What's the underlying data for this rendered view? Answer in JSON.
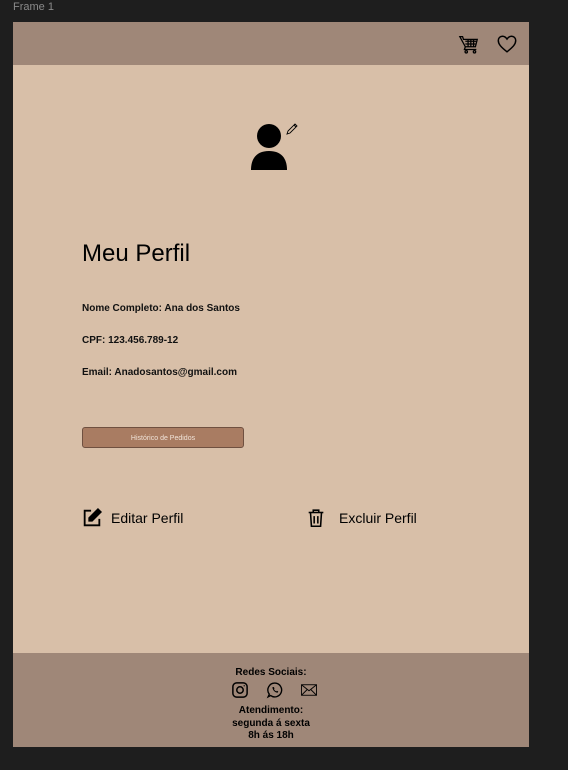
{
  "frame": {
    "label": "Frame 1"
  },
  "header": {
    "icons": [
      "cart-icon",
      "heart-icon"
    ]
  },
  "profile": {
    "title": "Meu Perfil",
    "full_name": "Nome Completo: Ana dos Santos",
    "cpf": "CPF: 123.456.789-12",
    "email": "Email: Anadosantos@gmail.com",
    "orders_button": "Histórico de Pedidos",
    "edit_label": "Editar Perfil",
    "delete_label": "Excluir Perfil"
  },
  "footer": {
    "social_title": "Redes Sociais:",
    "social_icons": [
      "instagram-icon",
      "whatsapp-icon",
      "mail-icon"
    ],
    "hours_title": "Atendimento:",
    "hours_days": "segunda á sexta",
    "hours_time": "8h ás 18h"
  },
  "colors": {
    "background": "#d8bfa8",
    "header_footer": "#9f8778",
    "button": "#a97c62"
  }
}
